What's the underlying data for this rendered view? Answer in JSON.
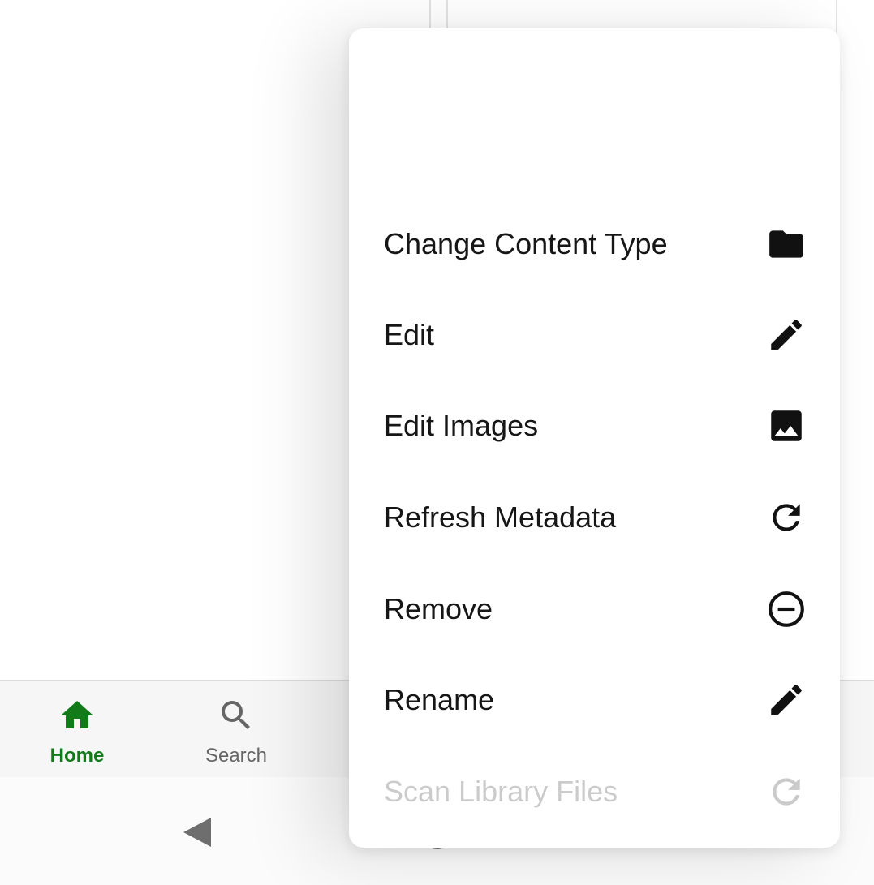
{
  "colors": {
    "accent": "#137a1a",
    "nav_inactive": "#666666",
    "menu_text": "#161616",
    "system_icon": "#6e6e6e"
  },
  "context_menu": {
    "items": [
      {
        "label": "Change Content Type",
        "icon": "folder-icon",
        "enabled": true
      },
      {
        "label": "Edit",
        "icon": "pencil-icon",
        "enabled": true
      },
      {
        "label": "Edit Images",
        "icon": "image-icon",
        "enabled": true
      },
      {
        "label": "Refresh Metadata",
        "icon": "refresh-icon",
        "enabled": true
      },
      {
        "label": "Remove",
        "icon": "minus-circle-icon",
        "enabled": true
      },
      {
        "label": "Rename",
        "icon": "pencil-icon",
        "enabled": true
      },
      {
        "label": "Scan Library Files",
        "icon": "refresh-icon",
        "enabled": false
      }
    ]
  },
  "bottom_nav": {
    "items": [
      {
        "label": "Home",
        "icon": "home-icon",
        "selected": true
      },
      {
        "label": "Search",
        "icon": "search-icon",
        "selected": false
      }
    ]
  },
  "system_nav": {
    "buttons": [
      {
        "icon": "back-triangle-icon"
      },
      {
        "icon": "home-circle-icon"
      },
      {
        "icon": "recents-square-icon"
      }
    ]
  }
}
